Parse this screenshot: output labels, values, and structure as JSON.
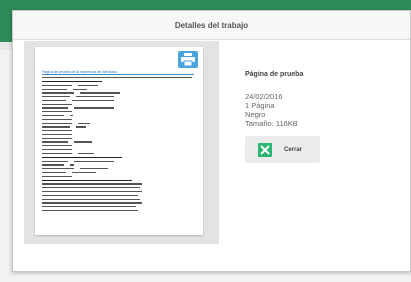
{
  "dialog": {
    "title": "Detalles del trabajo",
    "close_label": "Cerrar"
  },
  "job": {
    "name": "Página de prueba",
    "date": "24/02/2016",
    "pages": "1 Página",
    "color": "Negro",
    "size": "Tamaño: 116KB"
  },
  "preview": {
    "title_text": "Página de prueba de la impresora de Windows"
  },
  "colors": {
    "accent_green": "#2bb673",
    "printer_blue": "#4aa3df",
    "top_strip": "#2e8b57"
  }
}
